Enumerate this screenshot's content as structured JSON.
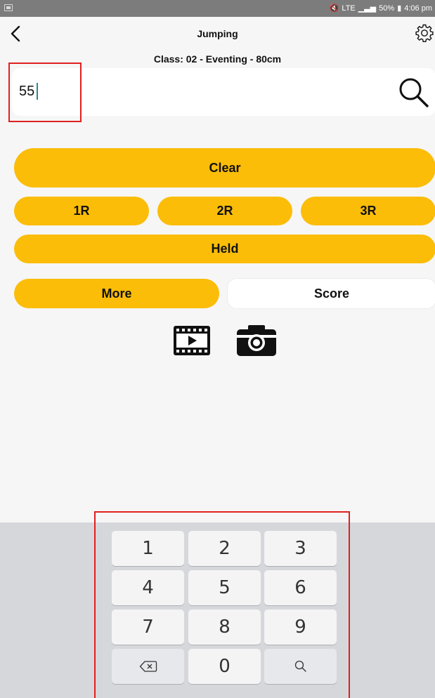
{
  "status_bar": {
    "battery": "50%",
    "time": "4:06 pm",
    "signal": "LTE"
  },
  "header": {
    "title": "Jumping",
    "subtitle": "Class: 02 - Eventing - 80cm"
  },
  "search": {
    "value": "55",
    "placeholder": ""
  },
  "buttons": {
    "clear": "Clear",
    "r1": "1R",
    "r2": "2R",
    "r3": "3R",
    "held": "Held",
    "more": "More",
    "score": "Score"
  },
  "keypad": {
    "k1": "1",
    "k2": "2",
    "k3": "3",
    "k4": "4",
    "k5": "5",
    "k6": "6",
    "k7": "7",
    "k8": "8",
    "k9": "9",
    "k0": "0"
  },
  "colors": {
    "accent": "#fbbd08",
    "highlight": "#e0201f",
    "caret": "#2a8a8a"
  },
  "icons": [
    "back-arrow-icon",
    "settings-gear-icon",
    "search-icon",
    "video-icon",
    "camera-icon",
    "backspace-icon",
    "keypad-search-icon"
  ]
}
